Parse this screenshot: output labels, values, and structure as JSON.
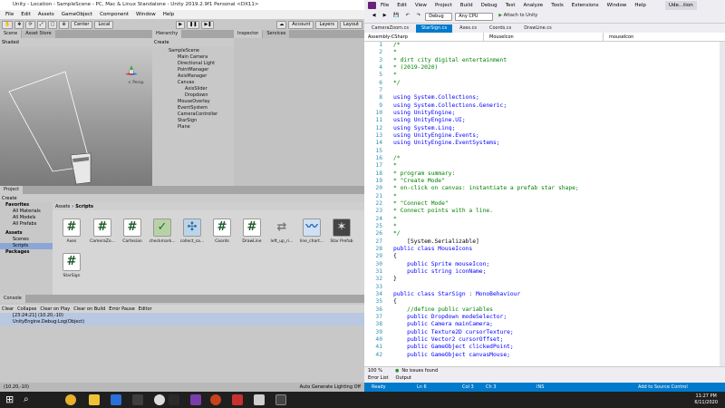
{
  "unity": {
    "title": "Unity - Location - SampleScene - PC, Mac & Linux Standalone - Unity 2019.2.9f1 Personal <DX11>",
    "menu": [
      "File",
      "Edit",
      "Assets",
      "GameObject",
      "Component",
      "Window",
      "Help"
    ],
    "center_label": "Center",
    "local_label": "Local",
    "account_label": "Account",
    "layers_label": "Layers",
    "layout_label": "Layout",
    "scene_tabs": [
      "Scene",
      "Asset Store"
    ],
    "shading": "Shaded",
    "persp_label": "< Persp",
    "hierarchy_tab": "Hierarchy",
    "create_label": "Create",
    "hierarchy_items": [
      "SampleScene",
      "Main Camera",
      "Directional Light",
      "PointManager",
      "AxisManager",
      "Canvas",
      "AxisSlider",
      "Dropdown",
      "MouseOverlay",
      "EventSystem",
      "CameraController",
      "StarSign",
      "Plane"
    ],
    "inspector_tabs": [
      "Inspector",
      "Services"
    ],
    "project_tab": "Project",
    "project_create": "Create",
    "favorites": [
      "Favorites",
      "All Materials",
      "All Models",
      "All Prefabs"
    ],
    "assets_tree": [
      "Assets",
      "Scenes",
      "Scripts",
      "Packages"
    ],
    "breadcrumb": [
      "Assets",
      "Scripts"
    ],
    "assets": [
      "Axes",
      "CameraZo...",
      "Cartesian",
      "checkmark...",
      "collect_sa...",
      "Coords",
      "DrawLine",
      "left_up_ri...",
      "line_chart...",
      "Star Prefab",
      "StarSign"
    ],
    "console_tab": "Console",
    "console_buttons": [
      "Clear",
      "Collapse",
      "Clear on Play",
      "Clear on Build",
      "Error Pause",
      "Editor"
    ],
    "log_line1": "[23:24:21] (10.20,-10)",
    "log_line2": "UnityEngine.Debug:Log(Object)",
    "status_left": "(10.20,-10)",
    "status_right": "Auto Generate Lighting Off"
  },
  "vs": {
    "menu": [
      "File",
      "Edit",
      "View",
      "Project",
      "Build",
      "Debug",
      "Test",
      "Analyze",
      "Tools",
      "Extensions",
      "Window",
      "Help"
    ],
    "config": "Debug",
    "platform": "Any CPU",
    "attach": "Attach to Unity",
    "user": "Ude...tion",
    "tabs": [
      "CameraZoom.cs",
      "StarSign.cs",
      "Axes.cs",
      "Coords.cs",
      "DrawLine.cs"
    ],
    "nav": [
      "Assembly-CSharp",
      "MouseIcon",
      "mouseIcon"
    ],
    "code": [
      {
        "n": "1",
        "t": "/*"
      },
      {
        "n": "2",
        "t": "*"
      },
      {
        "n": "3",
        "t": "* dirt city digital entertainment"
      },
      {
        "n": "4",
        "t": "* (2019-2020)"
      },
      {
        "n": "5",
        "t": "*"
      },
      {
        "n": "6",
        "t": "*/"
      },
      {
        "n": "7",
        "t": ""
      },
      {
        "n": "8",
        "t": "using System.Collections;"
      },
      {
        "n": "9",
        "t": "using System.Collections.Generic;"
      },
      {
        "n": "10",
        "t": "using UnityEngine;"
      },
      {
        "n": "11",
        "t": "using UnityEngine.UI;"
      },
      {
        "n": "12",
        "t": "using System.Linq;"
      },
      {
        "n": "13",
        "t": "using UnityEngine.Events;"
      },
      {
        "n": "14",
        "t": "using UnityEngine.EventSystems;"
      },
      {
        "n": "15",
        "t": ""
      },
      {
        "n": "16",
        "t": "/*"
      },
      {
        "n": "17",
        "t": "*"
      },
      {
        "n": "18",
        "t": "* program summary:"
      },
      {
        "n": "19",
        "t": "* \"Create Mode\""
      },
      {
        "n": "20",
        "t": "* on-click on canvas: instantiate a prefab star shape;"
      },
      {
        "n": "21",
        "t": "*"
      },
      {
        "n": "22",
        "t": "* \"Connect Mode\""
      },
      {
        "n": "23",
        "t": "* Connect points with a line."
      },
      {
        "n": "24",
        "t": "*"
      },
      {
        "n": "25",
        "t": "*"
      },
      {
        "n": "26",
        "t": "*/"
      },
      {
        "n": "27",
        "t": "    [System.Serializable]"
      },
      {
        "n": "28",
        "t": "public class MouseIcons"
      },
      {
        "n": "29",
        "t": "{"
      },
      {
        "n": "30",
        "t": "    public Sprite mouseIcon;"
      },
      {
        "n": "31",
        "t": "    public string iconName;"
      },
      {
        "n": "32",
        "t": "}"
      },
      {
        "n": "33",
        "t": ""
      },
      {
        "n": "34",
        "t": "public class StarSign : MonoBehaviour"
      },
      {
        "n": "35",
        "t": "{"
      },
      {
        "n": "36",
        "t": "    //define public variables"
      },
      {
        "n": "37",
        "t": "    public Dropdown modeSelector;"
      },
      {
        "n": "38",
        "t": "    public Camera mainCamera;"
      },
      {
        "n": "39",
        "t": "    public Texture2D cursorTexture;"
      },
      {
        "n": "40",
        "t": "    public Vector2 cursorOffset;"
      },
      {
        "n": "41",
        "t": "    public GameObject clickedPoint;"
      },
      {
        "n": "42",
        "t": "    public GameObject canvasMouse;"
      }
    ],
    "zoom": "100 %",
    "issues": "No issues found",
    "bottom_tabs": [
      "Error List",
      "Output"
    ],
    "status": {
      "ready": "Ready",
      "ln": "Ln 6",
      "col": "Col 3",
      "ch": "Ch 3",
      "ins": "INS",
      "source": "Add to Source Control"
    }
  },
  "taskbar": {
    "time": "11:27 PM",
    "date": "6/11/2020"
  },
  "colors": {
    "vs_blue": "#007acc",
    "comment": "#008000",
    "keyword": "#0000ff",
    "type": "#2b91af"
  }
}
